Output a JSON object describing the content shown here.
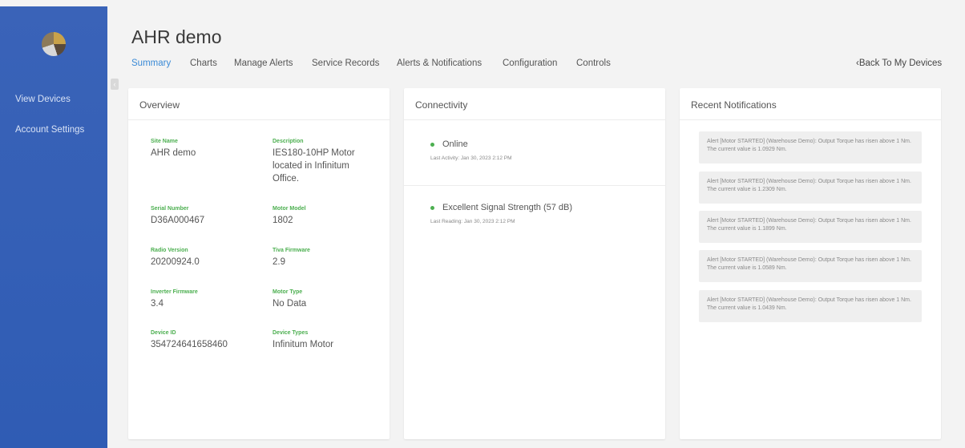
{
  "sidebar": {
    "items": [
      {
        "label": "View Devices"
      },
      {
        "label": "Account Settings"
      }
    ]
  },
  "header": {
    "title": "AHR demo",
    "back_link": "‹Back To My Devices"
  },
  "tabs": [
    {
      "label": "Summary",
      "active": true
    },
    {
      "label": "Charts"
    },
    {
      "label": "Manage Alerts"
    },
    {
      "label": "Service Records"
    },
    {
      "label": "Alerts & Notifications"
    },
    {
      "label": "Configuration"
    },
    {
      "label": "Controls"
    }
  ],
  "overview": {
    "title": "Overview",
    "fields": [
      {
        "label": "Site Name",
        "value": "AHR demo"
      },
      {
        "label": "Description",
        "value": "IES180-10HP Motor located in Infinitum Office."
      },
      {
        "label": "Serial Number",
        "value": "D36A000467"
      },
      {
        "label": "Motor Model",
        "value": "1802"
      },
      {
        "label": "Radio Version",
        "value": "20200924.0"
      },
      {
        "label": "Tiva Firmware",
        "value": "2.9"
      },
      {
        "label": "Inverter Firmware",
        "value": "3.4"
      },
      {
        "label": "Motor Type",
        "value": "No Data"
      },
      {
        "label": "Device ID",
        "value": "354724641658460"
      },
      {
        "label": "Device Types",
        "value": "Infinitum Motor"
      }
    ]
  },
  "connectivity": {
    "title": "Connectivity",
    "status": "Online",
    "last_activity": "Last Activity: Jan 30, 2023 2:12 PM",
    "signal": "Excellent Signal Strength (57 dB)",
    "last_reading": "Last Reading: Jan 30, 2023 2:12 PM",
    "status_color": "#4caf50"
  },
  "notifications": {
    "title": "Recent Notifications",
    "items": [
      "Alert [Motor STARTED] (Warehouse Demo): Output Torque has risen above 1 Nm. The current value is 1.0929 Nm.",
      "Alert [Motor STARTED] (Warehouse Demo): Output Torque has risen above 1 Nm. The current value is 1.2309 Nm.",
      "Alert [Motor STARTED] (Warehouse Demo): Output Torque has risen above 1 Nm. The current value is 1.1899 Nm.",
      "Alert [Motor STARTED] (Warehouse Demo): Output Torque has risen above 1 Nm. The current value is 1.0589 Nm.",
      "Alert [Motor STARTED] (Warehouse Demo): Output Torque has risen above 1 Nm. The current value is 1.0439 Nm."
    ]
  },
  "colors": {
    "sidebar": "#3a63b8",
    "accent": "#3a8ad6",
    "label_green": "#4caf50"
  }
}
